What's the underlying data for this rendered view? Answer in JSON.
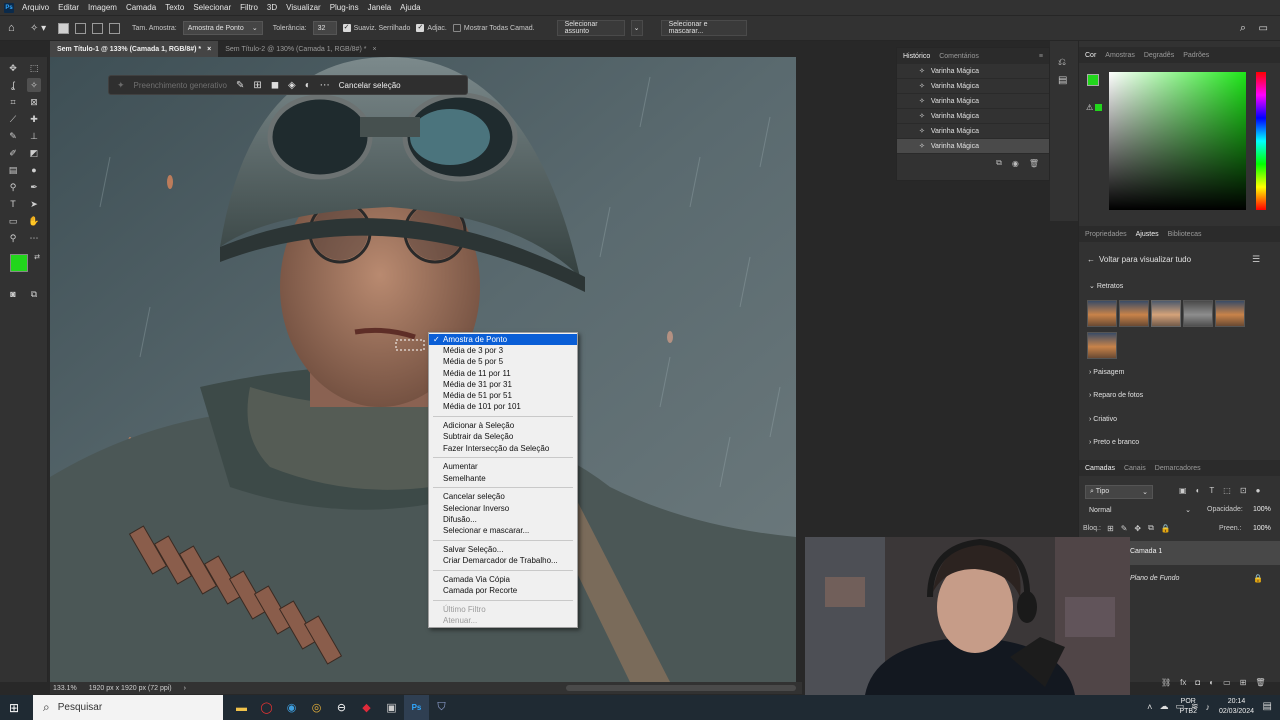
{
  "menubar": {
    "items": [
      "Arquivo",
      "Editar",
      "Imagem",
      "Camada",
      "Texto",
      "Selecionar",
      "Filtro",
      "3D",
      "Visualizar",
      "Plug-ins",
      "Janela",
      "Ajuda"
    ]
  },
  "options": {
    "sample_size_label": "Tam. Amostra:",
    "sample_size_value": "Amostra de Ponto",
    "tolerance_label": "Tolerância:",
    "tolerance_value": "32",
    "antialias_label": "Suaviz. Serrilhado",
    "contiguous_label": "Adjac.",
    "all_layers_label": "Mostrar Todas Camad.",
    "select_subject_label": "Selecionar assunto",
    "select_mask_label": "Selecionar e mascarar..."
  },
  "tabs": [
    {
      "label": "Sem Título-1 @ 133% (Camada 1, RGB/8#) *"
    },
    {
      "label": "Sem Título-2 @ 130% (Camada 1, RGB/8#) *"
    }
  ],
  "taskbar": {
    "generative_fill": "Preenchimento generativo",
    "cancel_selection": "Cancelar seleção"
  },
  "context_menu": {
    "items": [
      {
        "label": "Amostra de Ponto",
        "checked": true
      },
      {
        "label": "Média de 3 por 3"
      },
      {
        "label": "Média de 5 por 5"
      },
      {
        "label": "Média de 11 por 11"
      },
      {
        "label": "Média de 31 por 31"
      },
      {
        "label": "Média de 51 por 51"
      },
      {
        "label": "Média de 101 por 101"
      },
      {
        "label": "Adicionar à Seleção"
      },
      {
        "label": "Subtrair da Seleção"
      },
      {
        "label": "Fazer Intersecção da Seleção"
      },
      {
        "label": "Aumentar"
      },
      {
        "label": "Semelhante"
      },
      {
        "label": "Cancelar seleção"
      },
      {
        "label": "Selecionar Inverso"
      },
      {
        "label": "Difusão..."
      },
      {
        "label": "Selecionar e mascarar..."
      },
      {
        "label": "Salvar Seleção..."
      },
      {
        "label": "Criar Demarcador de Trabalho..."
      },
      {
        "label": "Camada Via Cópia"
      },
      {
        "label": "Camada por Recorte"
      },
      {
        "label": "Último Filtro"
      },
      {
        "label": "Atenuar..."
      }
    ]
  },
  "history": {
    "tabs": [
      "Histórico",
      "Comentários"
    ],
    "rows": [
      "Varinha Mágica",
      "Varinha Mágica",
      "Varinha Mágica",
      "Varinha Mágica",
      "Varinha Mágica",
      "Varinha Mágica"
    ]
  },
  "color_panel": {
    "tabs": [
      "Cor",
      "Amostras",
      "Degradês",
      "Padrões"
    ],
    "foreground": "#22d61c"
  },
  "adjustments": {
    "tabs": [
      "Propriedades",
      "Ajustes",
      "Bibliotecas"
    ],
    "back_label": "Voltar para visualizar tudo",
    "sections": [
      "Retratos",
      "Paisagem",
      "Reparo de fotos",
      "Criativo",
      "Preto e branco"
    ]
  },
  "layers": {
    "tabs": [
      "Camadas",
      "Canais",
      "Demarcadores"
    ],
    "filter": "Tipo",
    "blend_mode": "Normal",
    "opacity_label": "Opacidade:",
    "opacity_value": "100%",
    "lock_label": "Bloq.:",
    "fill_label": "Preen.:",
    "fill_value": "100%",
    "items": [
      "Camada 1",
      "Plano de Fundo"
    ]
  },
  "status": {
    "zoom": "133.1%",
    "doc_size": "1920 px x 1920 px (72 ppi)"
  },
  "windows_taskbar": {
    "search_placeholder": "Pesquisar",
    "lang": "POR",
    "layout": "PTB2",
    "time": "20:14",
    "date": "02/03/2024"
  }
}
